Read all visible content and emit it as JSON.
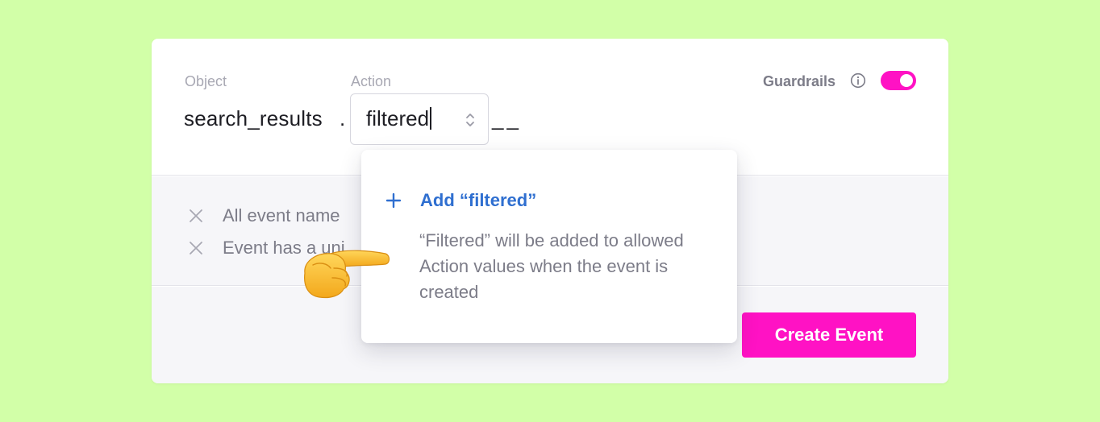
{
  "form": {
    "object_label": "Object",
    "object_value": "search_results",
    "separator": ".",
    "action_label": "Action",
    "action_value": "filtered",
    "trailing_placeholder": "__"
  },
  "guardrails": {
    "label": "Guardrails",
    "enabled": true,
    "toggle_color": "#ff12c4"
  },
  "rules": [
    {
      "icon": "x-icon",
      "text": "All event name"
    },
    {
      "icon": "x-icon",
      "text": "Event has a uni"
    }
  ],
  "dropdown": {
    "add_label": "Add “filtered”",
    "description": "“Filtered” will be added to allowed Action values when the event is created"
  },
  "actions": {
    "create_label": "Create Event"
  },
  "colors": {
    "background": "#d2ffa8",
    "accent": "#ff12c4",
    "link": "#2f6fd0",
    "muted_text": "#7c7c88"
  },
  "decorations": {
    "pointer": "pointing-hand-emoji"
  }
}
